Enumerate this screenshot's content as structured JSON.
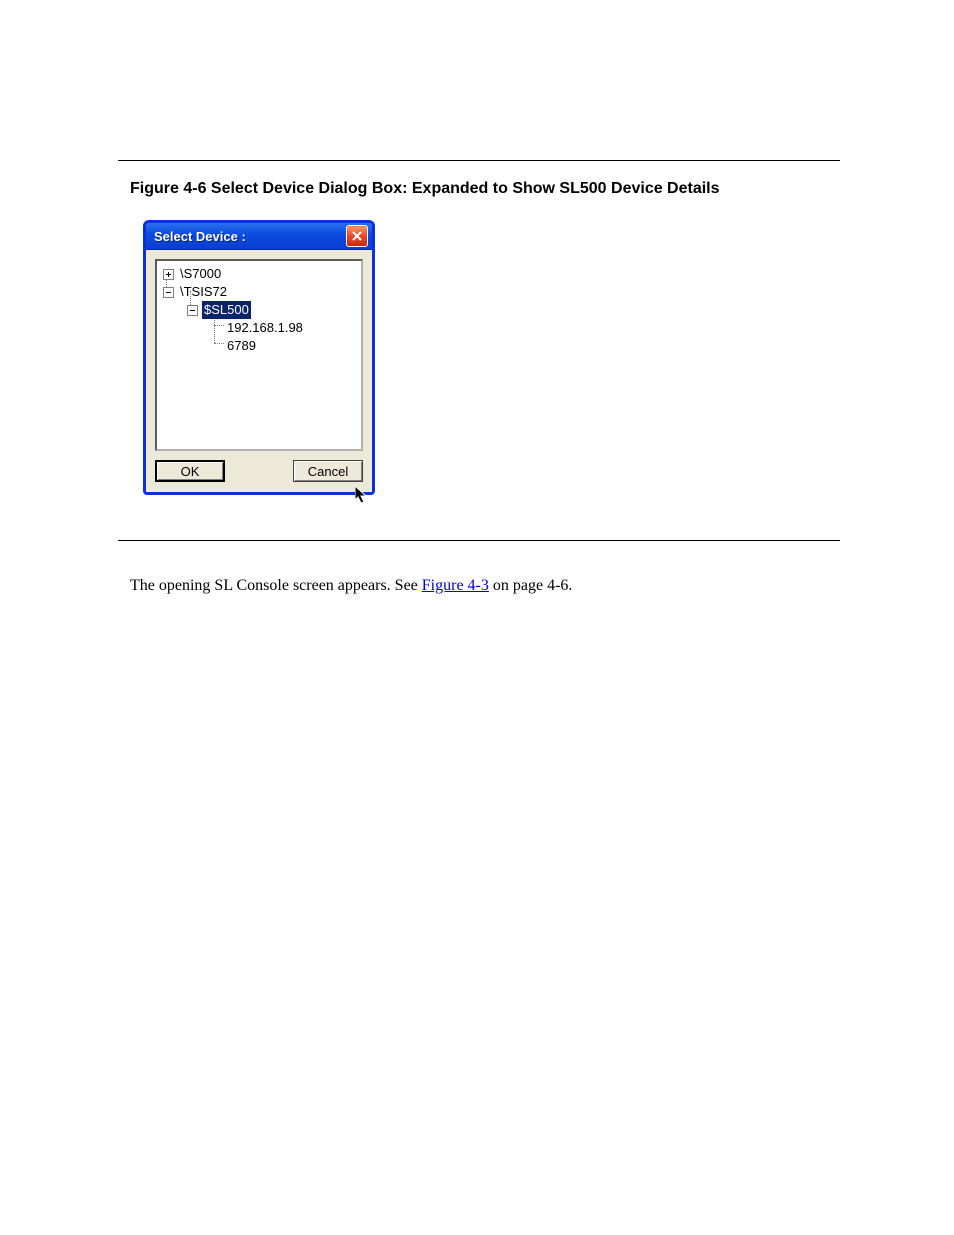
{
  "caption_top": "Figure 4-6 Select Device Dialog Box: Expanded to Show SL500 Device Details",
  "dialog": {
    "title": "Select Device :",
    "tree": {
      "node0": "\\S7000",
      "node1": "\\TSIS72",
      "node2": "$SL500",
      "node3": "192.168.1.98",
      "node4": "6789"
    },
    "ok_label": "OK",
    "cancel_label": "Cancel"
  },
  "body1_prefix": "The opening SL Console screen appears. See ",
  "body1_link": "Figure 4-3",
  "body1_suffix": " on page 4-6."
}
